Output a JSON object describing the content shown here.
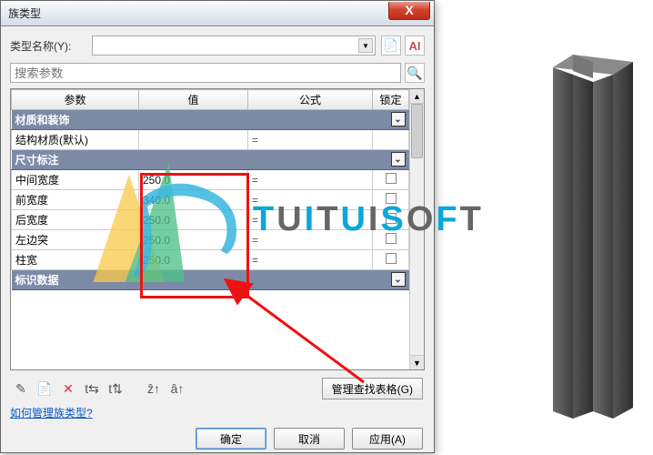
{
  "dialog": {
    "title": "族类型",
    "close_x": "X",
    "type_name_label": "类型名称(Y):",
    "type_name_value": "",
    "search_placeholder": "搜索参数"
  },
  "columns": {
    "param": "参数",
    "value": "值",
    "formula": "公式",
    "lock": "锁定"
  },
  "sections": {
    "material": {
      "header": "材质和装饰",
      "rows": [
        {
          "param": "结构材质(默认)",
          "value": ""
        }
      ]
    },
    "dimension": {
      "header": "尺寸标注",
      "rows": [
        {
          "param": "中间宽度",
          "value": "250.0"
        },
        {
          "param": "前宽度",
          "value": "340.0"
        },
        {
          "param": "后宽度",
          "value": "250.0"
        },
        {
          "param": "左边突",
          "value": "250.0"
        },
        {
          "param": "柱宽",
          "value": "250.0"
        }
      ]
    },
    "identity": {
      "header": "标识数据"
    }
  },
  "buttons": {
    "lookup": "管理查找表格(G)",
    "ok": "确定",
    "cancel": "取消",
    "apply": "应用(A)"
  },
  "link": "如何管理族类型?",
  "watermark": "TUITUISOFT",
  "toolbar_icons": {
    "new": "📄",
    "rename": "AI"
  },
  "bottom_icons": [
    "✎",
    "📄",
    "✕",
    "t⇆",
    "t⇅",
    "ẑ↑",
    "â↑"
  ]
}
